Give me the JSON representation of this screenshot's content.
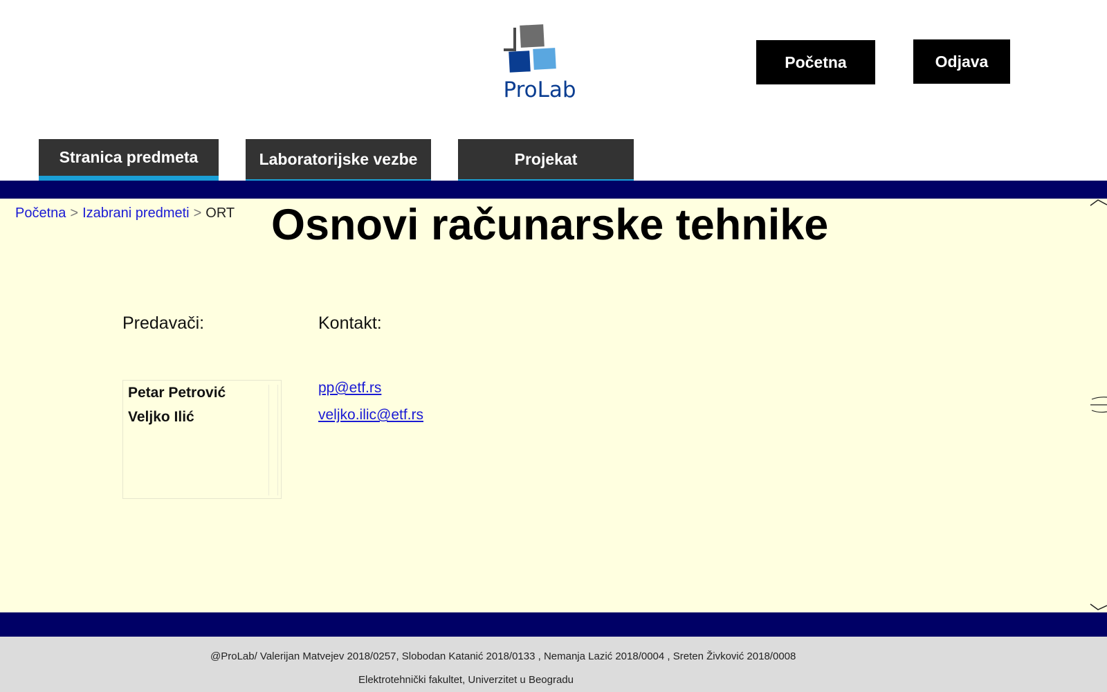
{
  "header": {
    "logo_text": "ProLab",
    "home_button": "Početna",
    "logout_button": "Odjava"
  },
  "tabs": [
    {
      "label": "Stranica predmeta",
      "active": true
    },
    {
      "label": "Laboratorijske vezbe",
      "active": false
    },
    {
      "label": "Projekat",
      "active": false
    }
  ],
  "breadcrumb": {
    "items": [
      "Početna",
      "Izabrani predmeti",
      "ORT"
    ],
    "separator": ">"
  },
  "course": {
    "title": "Osnovi računarske tehnike",
    "lecturers_label": "Predavači:",
    "contact_label": "Kontakt:",
    "lecturers": [
      "Petar Petrović",
      "Veljko Ilić"
    ],
    "contacts": [
      "pp@etf.rs",
      "veljko.ilic@etf.rs"
    ]
  },
  "footer": {
    "authors": "@ProLab/ Valerijan Matvejev 2018/0257, Slobodan Katanić 2018/0133 , Nemanja Lazić 2018/0004 , Sreten Živković 2018/0008",
    "institution": "Elektrotehnički fakultet, Univerzitet u Beogradu"
  },
  "colors": {
    "band": "#000066",
    "content_bg": "#ffffe0",
    "tab_bg": "#333333",
    "tab_accent": "#1a9fd6",
    "link": "#1a1ad4",
    "logo_blue": "#0a3d91"
  }
}
